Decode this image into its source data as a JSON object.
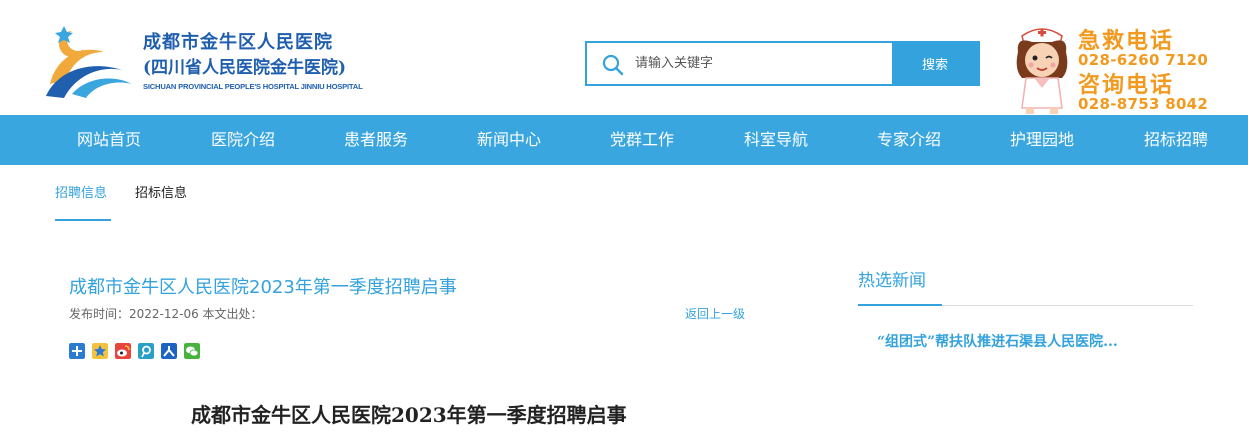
{
  "header": {
    "hospital_name_cn": "成都市金牛区人民医院",
    "hospital_name_cn_alt": "(四川省人民医院金牛医院)",
    "hospital_name_en": "SICHUAN PROVINCIAL PEOPLE'S HOSPITAL JINNIU HOSPITAL",
    "logo_icon": "hospital-logo-icon",
    "search": {
      "placeholder": "请输入关键字",
      "button_label": "搜索"
    },
    "emergency": {
      "label": "急救电话",
      "number": "028-6260 7120"
    },
    "consult": {
      "label": "咨询电话",
      "number": "028-8753 8042"
    },
    "mascot_icon": "nurse-mascot-icon"
  },
  "nav": {
    "items": [
      "网站首页",
      "医院介绍",
      "患者服务",
      "新闻中心",
      "党群工作",
      "科室导航",
      "专家介绍",
      "护理园地",
      "招标招聘"
    ]
  },
  "subtabs": {
    "recruit": "招聘信息",
    "bid": "招标信息"
  },
  "article": {
    "title": "成都市金牛区人民医院2023年第一季度招聘启事",
    "meta": "发布时间：2022-12-06 本文出处：",
    "back_label": "返回上一级",
    "share_icons": [
      "share-more-icon",
      "qzone-icon",
      "weibo-icon",
      "tencent-weibo-icon",
      "renren-icon",
      "wechat-icon"
    ],
    "heading": "成都市金牛区人民医院2023年第一季度招聘启事"
  },
  "sidebar": {
    "hot_title": "热选新闻",
    "items": [
      "“组团式”帮扶队推进石渠县人民医院..."
    ]
  },
  "colors": {
    "brand_blue": "#33a2dd",
    "nav_blue": "#3aa6e0",
    "logo_blue": "#1f5fae",
    "phone_orange": "#f29a1f"
  }
}
